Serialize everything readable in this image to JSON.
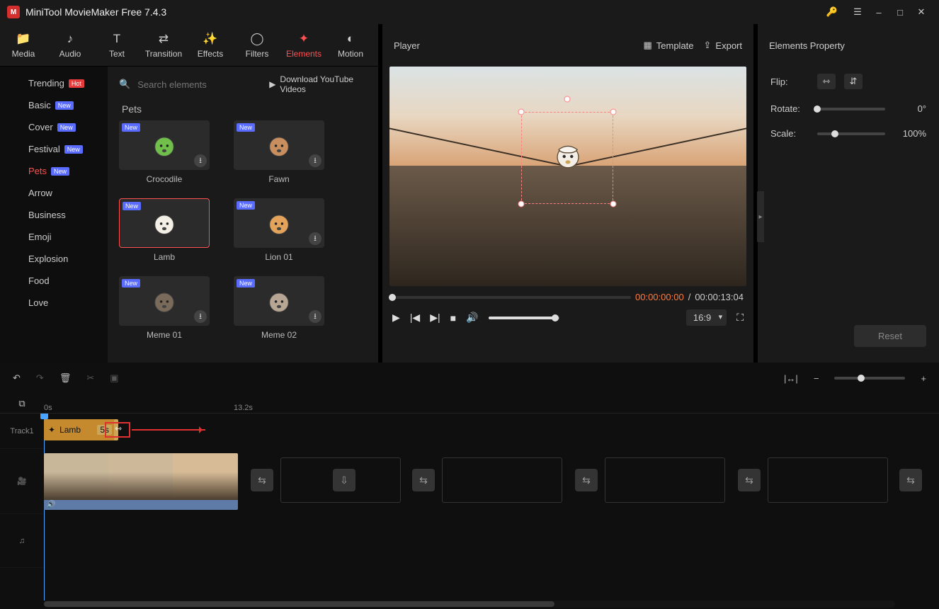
{
  "app": {
    "title": "MiniTool MovieMaker Free 7.4.3"
  },
  "tabs": [
    {
      "id": "media",
      "label": "Media"
    },
    {
      "id": "audio",
      "label": "Audio"
    },
    {
      "id": "text",
      "label": "Text"
    },
    {
      "id": "transition",
      "label": "Transition"
    },
    {
      "id": "effects",
      "label": "Effects"
    },
    {
      "id": "filters",
      "label": "Filters"
    },
    {
      "id": "elements",
      "label": "Elements"
    },
    {
      "id": "motion",
      "label": "Motion"
    }
  ],
  "active_tab": "elements",
  "categories": [
    {
      "id": "trending",
      "label": "Trending",
      "badge": "Hot"
    },
    {
      "id": "basic",
      "label": "Basic",
      "badge": "New"
    },
    {
      "id": "cover",
      "label": "Cover",
      "badge": "New"
    },
    {
      "id": "festival",
      "label": "Festival",
      "badge": "New"
    },
    {
      "id": "pets",
      "label": "Pets",
      "badge": "New"
    },
    {
      "id": "arrow",
      "label": "Arrow"
    },
    {
      "id": "business",
      "label": "Business"
    },
    {
      "id": "emoji",
      "label": "Emoji"
    },
    {
      "id": "explosion",
      "label": "Explosion"
    },
    {
      "id": "food",
      "label": "Food"
    },
    {
      "id": "love",
      "label": "Love"
    }
  ],
  "active_category": "pets",
  "search": {
    "placeholder": "Search elements"
  },
  "download_videos_label": "Download YouTube Videos",
  "grid": {
    "title": "Pets",
    "items": [
      {
        "id": "crocodile",
        "label": "Crocodile",
        "new": true,
        "download": true,
        "color": "#6fbf4a"
      },
      {
        "id": "fawn",
        "label": "Fawn",
        "new": true,
        "download": true,
        "color": "#c98e5e"
      },
      {
        "id": "lamb",
        "label": "Lamb",
        "new": true,
        "selected": true,
        "color": "#f3efe7"
      },
      {
        "id": "lion01",
        "label": "Lion 01",
        "new": true,
        "download": true,
        "color": "#e3a35a"
      },
      {
        "id": "meme01",
        "label": "Meme 01",
        "new": true,
        "download": true,
        "color": "#7a6a5a"
      },
      {
        "id": "meme02",
        "label": "Meme 02",
        "new": true,
        "download": true,
        "color": "#b6a693"
      }
    ]
  },
  "player": {
    "title": "Player",
    "template_label": "Template",
    "export_label": "Export",
    "current_tc": "00:00:00:00",
    "total_tc": "00:00:13:04",
    "aspect": "16:9"
  },
  "properties": {
    "title": "Elements Property",
    "flip_label": "Flip:",
    "rotate_label": "Rotate:",
    "rotate_value": "0°",
    "scale_label": "Scale:",
    "scale_value": "100%",
    "reset_label": "Reset"
  },
  "timeline": {
    "ruler": {
      "t0": "0s",
      "t1": "13.2s"
    },
    "track1_label": "Track1",
    "clip": {
      "name": "Lamb",
      "duration": "5s"
    }
  }
}
